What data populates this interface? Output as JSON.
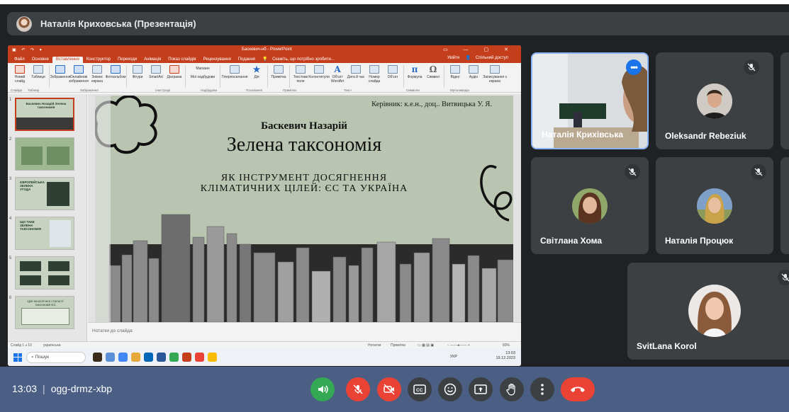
{
  "presenter_bar": {
    "title": "Наталія Криховська (Презентація)"
  },
  "powerpoint": {
    "window_title": "Баскевич-нб - PowerPoint",
    "tabs": [
      "Файл",
      "Основне",
      "Вставлення",
      "Конструктор",
      "Переходи",
      "Анімація",
      "Показ слайдів",
      "Рецензування",
      "Подання"
    ],
    "active_tab": "Вставлення",
    "tell_me": "Скажіть, що потрібно зробити...",
    "user": "Увійти",
    "share": "Спільний доступ",
    "ribbon": [
      "Новий слайд",
      "Таблиця",
      "Зображення",
      "Онлайнові зображення",
      "Знімок екрана",
      "Фотоальбом",
      "Фігури",
      "SmartArt",
      "Діаграма",
      "Магазин",
      "Мої надбудови",
      "Гіперпосилання",
      "Дія",
      "Примітка",
      "Текстове поле",
      "Колонтитули",
      "Об'єкт WordArt",
      "Дата й час",
      "Номер слайда",
      "Об'єкт",
      "Формула",
      "Символ",
      "Відео",
      "Аудіо",
      "Записування з екрана"
    ],
    "groups": [
      "Слайди",
      "Таблиці",
      "Зображення",
      "Ілюстрації",
      "Надбудови",
      "Посилання",
      "Примітки",
      "Текст",
      "Символи",
      "Мультимедіа"
    ],
    "thumbnails": [
      {
        "num": "1",
        "caption": "Баскевич Назарій Зелена таксономія"
      },
      {
        "num": "2",
        "caption": ""
      },
      {
        "num": "3",
        "caption": "ЄВРОПЕЙСЬКА ЗЕЛЕНА УГОДА"
      },
      {
        "num": "4",
        "caption": "ЩО ТАКЕ ЗЕЛЕНА ТАКСОНОМІЯ"
      },
      {
        "num": "5",
        "caption": ""
      },
      {
        "num": "6",
        "caption": "Цілі екологічної сталості таксономії ЄС"
      }
    ],
    "slide": {
      "supervisor": "Керівник: к.е.н., доц.. Витвицька У. Я.",
      "author": "Баскевич Назарій",
      "title": "Зелена таксономія",
      "subtitle_line1": "ЯК ІНСТРУМЕНТ ДОСЯГНЕННЯ",
      "subtitle_line2": "КЛІМАТИЧНИХ ЦІЛЕЙ: ЄС ТА УКРАЇНА"
    },
    "notes_placeholder": "Нотатки до слайда",
    "status": {
      "slide_counter": "Слайд 1 з 10",
      "language": "українська",
      "notes_btn": "Нотатки",
      "comments_btn": "Примітки",
      "zoom": "83%"
    },
    "taskbar": {
      "search": "Пошук",
      "lang": "УКР",
      "time": "13:03",
      "date": "19.12.2023"
    }
  },
  "participants": [
    {
      "name": "Наталія Крихівська",
      "selected": true,
      "muted": false
    },
    {
      "name": "Oleksandr Rebeziuk",
      "muted": true
    },
    {
      "name": "Світлана Хома",
      "muted": true
    },
    {
      "name": "Наталія Процюк",
      "muted": true
    },
    {
      "name": "SvitLana Korol",
      "muted": true
    }
  ],
  "bottom_bar": {
    "time": "13:03",
    "meeting_code": "ogg-drmz-xbp"
  },
  "colors": {
    "meet_bg": "#202124",
    "tile_bg": "#3c4043",
    "bottom_bar": "#4b5e84",
    "ppt_accent": "#c43e1c",
    "red_button": "#ea4335",
    "green_button": "#34a853"
  },
  "icons": [
    "mic-on-icon",
    "mic-off-icon",
    "camera-off-icon",
    "captions-icon",
    "emoji-icon",
    "present-icon",
    "raise-hand-icon",
    "more-options-icon",
    "end-call-icon"
  ]
}
